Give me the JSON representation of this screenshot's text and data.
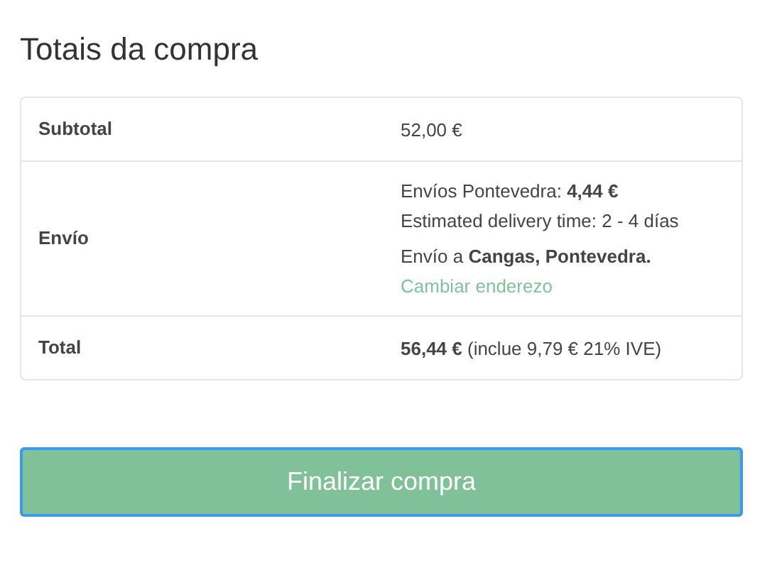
{
  "heading": "Totais da compra",
  "rows": [
    {
      "label": "Subtotal",
      "lines": [
        {
          "kind": "text",
          "text": "52,00 €"
        }
      ]
    },
    {
      "label": "Envío",
      "lines": [
        {
          "kind": "text",
          "text": "Envíos Pontevedra: **4,44 €**"
        },
        {
          "kind": "text",
          "text": "Estimated delivery time: 2 - 4 días"
        },
        {
          "kind": "gap-text",
          "text": "Envío a **Cangas, Pontevedra.**"
        },
        {
          "kind": "link",
          "text": "Cambiar enderezo"
        }
      ]
    },
    {
      "label": "Total",
      "lines": [
        {
          "kind": "text",
          "text": "**56,44 €** (inclue 9,79 € 21% IVE)"
        }
      ]
    }
  ],
  "button": "Finalizar compra"
}
